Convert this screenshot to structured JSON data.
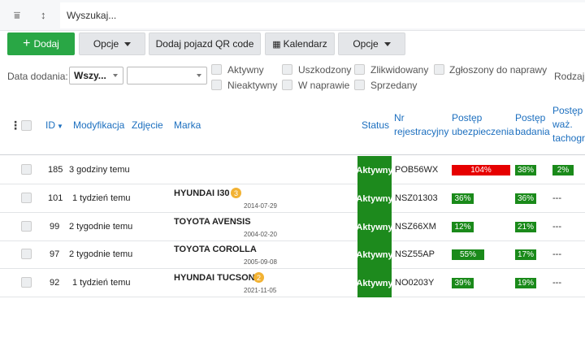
{
  "search": {
    "placeholder": "Wyszukaj..."
  },
  "toolbar": {
    "add_label": "Dodaj",
    "options_label": "Opcje",
    "qr_label": "Dodaj pojazd QR code",
    "calendar_label": "Kalendarz",
    "options2_label": "Opcje"
  },
  "filters": {
    "date_label": "Data dodania:",
    "date_select_value": "Wszy...",
    "second_select_value": "",
    "checkboxes": [
      "Aktywny",
      "Nieaktywny",
      "Uszkodzony",
      "W naprawie",
      "Zlikwidowany",
      "Sprzedany",
      "Zgłoszony do naprawy"
    ],
    "extra_label": "Rodzaj"
  },
  "columns": {
    "id": "ID",
    "modyfikacja": "Modyfikacja",
    "zdjecie": "Zdjęcie",
    "marka": "Marka",
    "status": "Status",
    "nr_rej_1": "Nr",
    "nr_rej_2": "rejestracyjny",
    "postep_ubezp_1": "Postęp",
    "postep_ubezp_2": "ubezpieczenia",
    "postep_bad_1": "Postęp",
    "postep_bad_2": "badania",
    "postep_tach_1": "Postęp",
    "postep_tach_2": "waż.",
    "postep_tach_3": "tachogra"
  },
  "rows": [
    {
      "id": "185",
      "mod": "3 godziny temu",
      "marka": "",
      "badge": "",
      "date": "",
      "status": "Aktywny",
      "nr": "POB56WX",
      "ubezp": "104%",
      "ubezp_pct": 104,
      "badanie": "38%",
      "badanie_pct": 38,
      "tacho": "2%",
      "tacho_pct": 2
    },
    {
      "id": "101",
      "mod": "1 tydzień temu",
      "marka": "HYUNDAI I30",
      "badge": "3",
      "date": "2014-07-29",
      "status": "Aktywny",
      "nr": "NSZ01303",
      "ubezp": "36%",
      "ubezp_pct": 36,
      "badanie": "36%",
      "badanie_pct": 36,
      "tacho": "---",
      "tacho_pct": null
    },
    {
      "id": "99",
      "mod": "2 tygodnie temu",
      "marka": "TOYOTA AVENSIS",
      "badge": "",
      "date": "2004-02-20",
      "status": "Aktywny",
      "nr": "NSZ66XM",
      "ubezp": "12%",
      "ubezp_pct": 12,
      "badanie": "21%",
      "badanie_pct": 21,
      "tacho": "---",
      "tacho_pct": null
    },
    {
      "id": "97",
      "mod": "2 tygodnie temu",
      "marka": "TOYOTA COROLLA",
      "badge": "",
      "date": "2005-09-08",
      "status": "Aktywny",
      "nr": "NSZ55AP",
      "ubezp": "55%",
      "ubezp_pct": 55,
      "badanie": "17%",
      "badanie_pct": 17,
      "tacho": "---",
      "tacho_pct": null
    },
    {
      "id": "92",
      "mod": "1 tydzień temu",
      "marka": "HYUNDAI TUCSON",
      "badge": "2",
      "date": "2021-11-05",
      "status": "Aktywny",
      "nr": "NO0203Y",
      "ubezp": "39%",
      "ubezp_pct": 39,
      "badanie": "19%",
      "badanie_pct": 19,
      "tacho": "---",
      "tacho_pct": null
    }
  ],
  "colors": {
    "green": "#29a745",
    "status_green": "#1d8a1d",
    "red": "#e60000",
    "link": "#1c6fbf",
    "badge": "#f2b233"
  }
}
